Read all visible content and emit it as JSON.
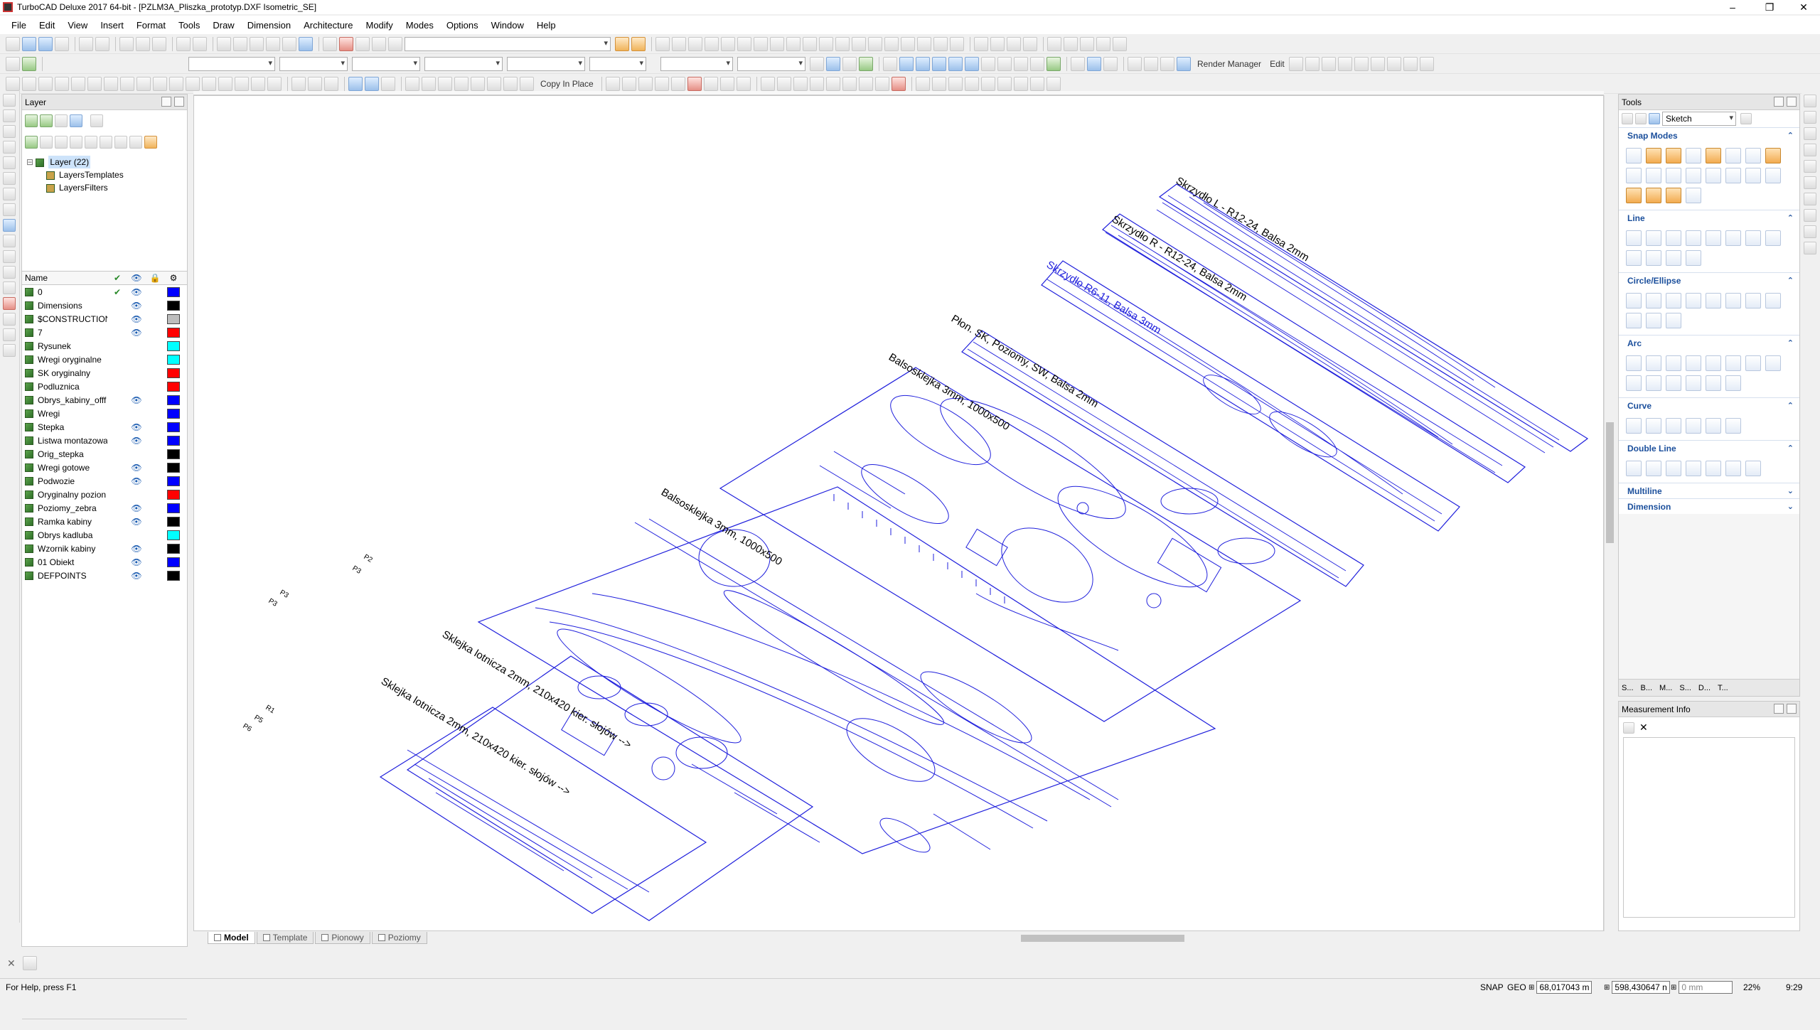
{
  "window": {
    "title": "TurboCAD Deluxe 2017 64-bit - [PZLM3A_Pliszka_prototyp.DXF Isometric_SE]",
    "controls": [
      "‒",
      "❐",
      "✕"
    ]
  },
  "menu": [
    "File",
    "Edit",
    "View",
    "Insert",
    "Format",
    "Tools",
    "Draw",
    "Dimension",
    "Architecture",
    "Modify",
    "Modes",
    "Options",
    "Window",
    "Help"
  ],
  "toolbar": {
    "render_manager": "Render Manager",
    "edit_label": "Edit",
    "copy_in_place": "Copy In Place"
  },
  "layer_panel": {
    "title": "Layer",
    "tree": {
      "root": "Layer (22)",
      "children": [
        "LayersTemplates",
        "LayersFilters"
      ]
    },
    "columns": {
      "name": "Name"
    },
    "layers": [
      {
        "name": "0",
        "current": "✔",
        "visible": "👁",
        "color": "#0000ff"
      },
      {
        "name": "Dimensions",
        "current": "",
        "visible": "👁",
        "color": "#000000"
      },
      {
        "name": "$CONSTRUCTION",
        "current": "",
        "visible": "👁",
        "color": "#bdbdbd"
      },
      {
        "name": "7",
        "current": "",
        "visible": "👁",
        "color": "#ff0000"
      },
      {
        "name": "Rysunek",
        "current": "",
        "visible": "",
        "color": "#00ffff"
      },
      {
        "name": "Wregi oryginalne",
        "current": "",
        "visible": "",
        "color": "#00ffff"
      },
      {
        "name": "SK oryginalny",
        "current": "",
        "visible": "",
        "color": "#ff0000"
      },
      {
        "name": "Podluznica",
        "current": "",
        "visible": "",
        "color": "#ff0000"
      },
      {
        "name": "Obrys_kabiny_offf",
        "current": "",
        "visible": "👁",
        "color": "#0000ff"
      },
      {
        "name": "Wregi",
        "current": "",
        "visible": "",
        "color": "#0000ff"
      },
      {
        "name": "Stepka",
        "current": "",
        "visible": "👁",
        "color": "#0000ff"
      },
      {
        "name": "Listwa montazowa",
        "current": "",
        "visible": "👁",
        "color": "#0000ff"
      },
      {
        "name": "Orig_stepka",
        "current": "",
        "visible": "",
        "color": "#000000"
      },
      {
        "name": "Wregi gotowe",
        "current": "",
        "visible": "👁",
        "color": "#000000"
      },
      {
        "name": "Podwozie",
        "current": "",
        "visible": "👁",
        "color": "#0000ff"
      },
      {
        "name": "Oryginalny pozion",
        "current": "",
        "visible": "",
        "color": "#ff0000"
      },
      {
        "name": "Poziomy_zebra",
        "current": "",
        "visible": "👁",
        "color": "#0000ff"
      },
      {
        "name": "Ramka kabiny",
        "current": "",
        "visible": "👁",
        "color": "#000000"
      },
      {
        "name": "Obrys kadluba",
        "current": "",
        "visible": "",
        "color": "#00ffff"
      },
      {
        "name": "Wzornik kabiny",
        "current": "",
        "visible": "👁",
        "color": "#000000"
      },
      {
        "name": "01 Obiekt",
        "current": "",
        "visible": "👁",
        "color": "#0000ff"
      },
      {
        "name": "DEFPOINTS",
        "current": "",
        "visible": "👁",
        "color": "#000000"
      }
    ]
  },
  "drawing": {
    "sheet_labels": [
      "Skrzydło L - R12-24, Balsa 2mm",
      "Skrzydło R - R12-24, Balsa 2mm",
      "Skrzydło R6-11, Balsa 3mm",
      "Płon. SK, Poziomy, SW, Balsa 2mm",
      "Balsosklejka 3mm, 1000x500",
      "Balsosklejka 3mm, 1000x500",
      "Sklejka lotnicza 2mm, 210x420 kier. słojów -->",
      "Sklejka lotnicza 2mm, 210x420 kier. słojów -->"
    ],
    "part_tags": [
      "P2",
      "P3",
      "P3",
      "P3",
      "R1",
      "P5",
      "P6"
    ]
  },
  "tabs": [
    "Model",
    "Template",
    "Pionowy",
    "Poziomy"
  ],
  "tools_panel": {
    "title": "Tools",
    "mode": "Sketch",
    "sections": [
      "Snap Modes",
      "Line",
      "Circle/Ellipse",
      "Arc",
      "Curve",
      "Double Line",
      "Multiline",
      "Dimension"
    ],
    "bottom_tabs": [
      "S...",
      "B...",
      "M...",
      "S...",
      "D...",
      "T..."
    ]
  },
  "measurement_panel": {
    "title": "Measurement Info"
  },
  "status": {
    "help": "For Help, press F1",
    "snap": "SNAP",
    "geo": "GEO",
    "x": "68,017043 m",
    "y": "598,430647 n",
    "z": "0 mm",
    "zoom": "22%",
    "time": "9:29"
  }
}
